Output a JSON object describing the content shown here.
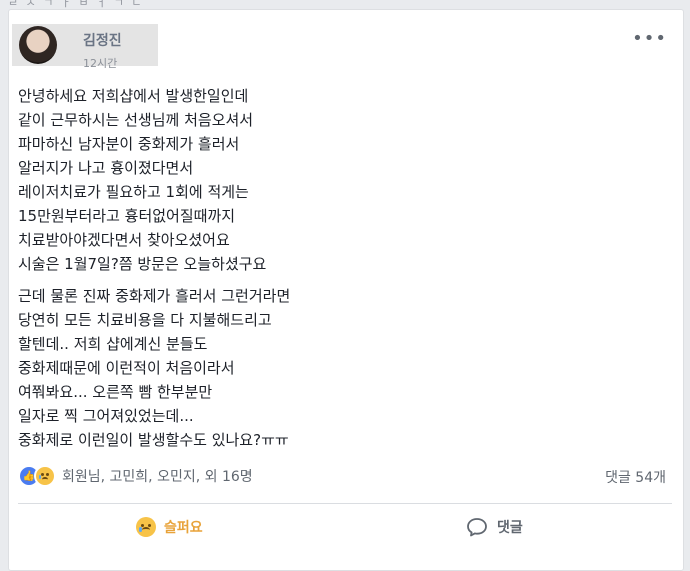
{
  "top": {
    "partial_text": "ㄹ ㅅ ㄱ ㅏ ㅂ ㅓ ㄱ ㄴ"
  },
  "post": {
    "author": "김정진",
    "time": "12시간",
    "paragraphs": [
      [
        "안녕하세요 저희샵에서 발생한일인데",
        "같이 근무하시는 선생님께 처음오셔서",
        "파마하신 남자분이 중화제가 흘러서",
        "알러지가 나고 흉이졌다면서",
        "레이저치료가 필요하고 1회에 적게는",
        "15만원부터라고 흉터없어질때까지",
        "치료받아야겠다면서 찾아오셨어요",
        "시술은 1월7일?쯤 방문은 오늘하셨구요"
      ],
      [
        "근데 물론 진짜 중화제가 흘러서 그런거라면",
        "당연히 모든 치료비용을 다 지불해드리고",
        "할텐데.. 저희 샵에계신 분들도",
        "중화제때문에 이런적이 처음이라서",
        "여쭤봐요... 오른쪽 빰 한부분만",
        "일자로 찍 그어져있었는데...",
        "중화제로 이런일이 발생할수도 있나요?ㅠㅠ"
      ]
    ]
  },
  "reactions": {
    "icons": [
      "like-icon",
      "sad-icon"
    ],
    "names": "회원님, 고민희, 오민지, 외 16명",
    "comment_count": "댓글 54개"
  },
  "actions": {
    "sad_label": "슬퍼요",
    "comment_label": "댓글"
  },
  "colors": {
    "background": "#e9ebee",
    "card": "#ffffff",
    "text": "#1d2129",
    "muted": "#606770",
    "sad_reaction": "#e8a33a",
    "like_blue": "#4a7cf0"
  }
}
